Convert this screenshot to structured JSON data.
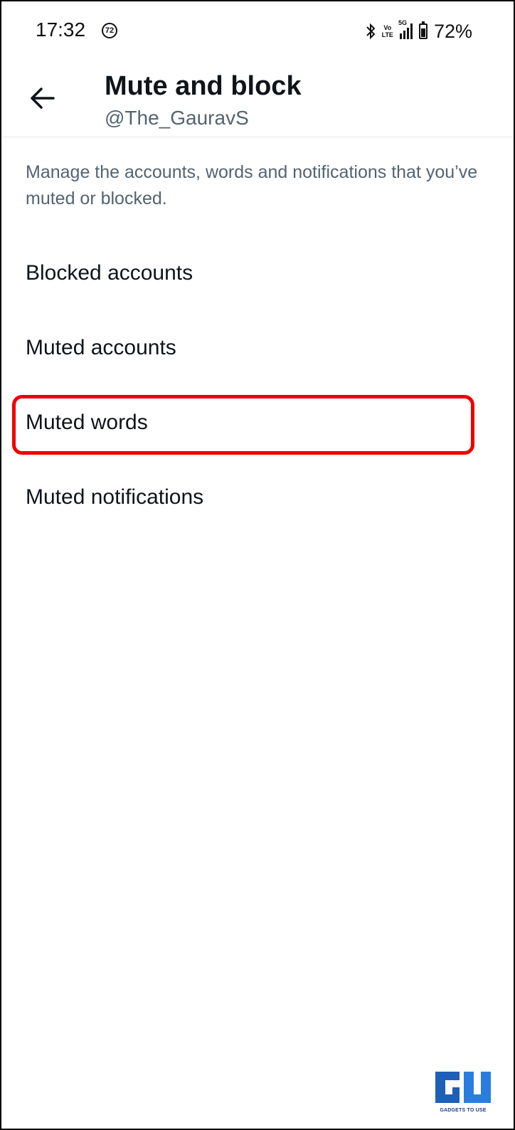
{
  "status_bar": {
    "time": "17:32",
    "notification_badge": "72",
    "volte_label_top": "Vo",
    "volte_label_bottom": "LTE",
    "network_label": "5G",
    "battery_percent": "72%",
    "battery_level": 0.72,
    "icons": [
      "bluetooth-icon",
      "volte-icon",
      "signal-icon",
      "battery-icon"
    ]
  },
  "header": {
    "title": "Mute and block",
    "subtitle": "@The_GauravS",
    "back_icon": "arrow-left-icon"
  },
  "description": "Manage the accounts, words and notifications that you’ve muted or blocked.",
  "menu": {
    "items": [
      {
        "label": "Blocked accounts"
      },
      {
        "label": "Muted accounts"
      },
      {
        "label": "Muted words",
        "highlighted": true
      },
      {
        "label": "Muted notifications"
      }
    ]
  },
  "colors": {
    "text_primary": "#0f1419",
    "text_secondary": "#536471",
    "highlight": "#ee0000",
    "watermark": "#1e5fb8"
  },
  "watermark": {
    "text": "GADGETS TO USE",
    "logo_icon": "gadgets-to-use-logo"
  }
}
